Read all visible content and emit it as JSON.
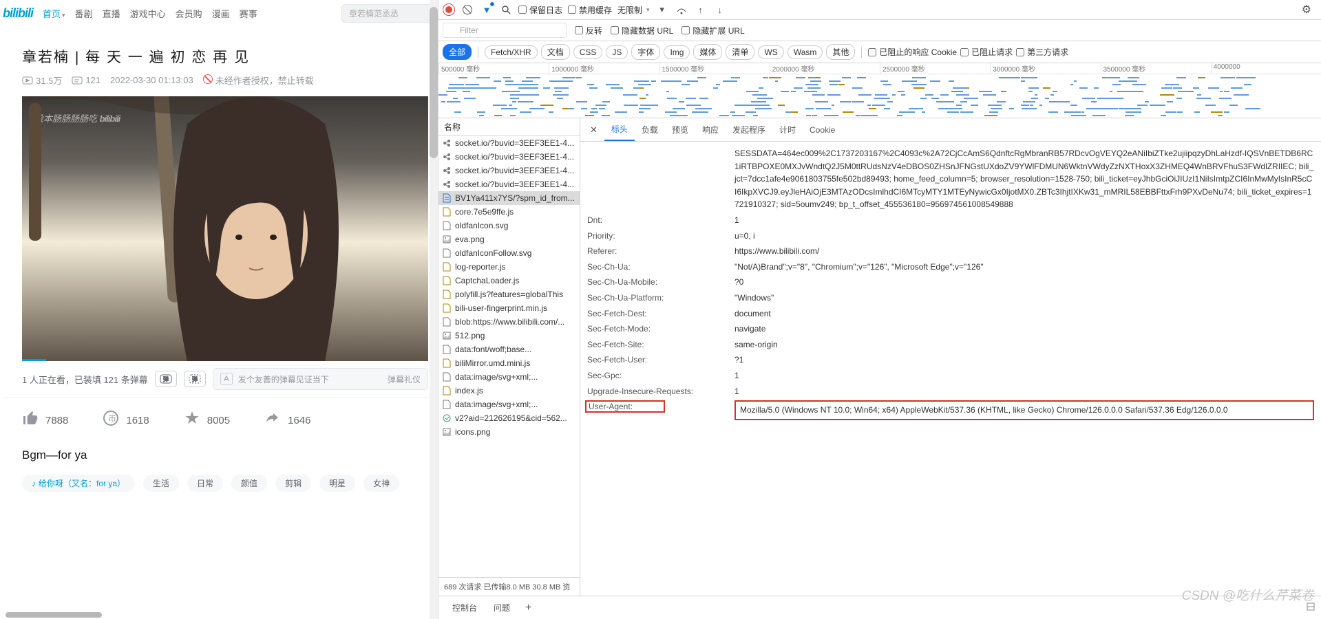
{
  "bili": {
    "logo": "bilibili",
    "nav": [
      "首页",
      "番剧",
      "直播",
      "游戏中心",
      "会员购",
      "漫画",
      "赛事"
    ],
    "search_placeholder": "章若楠范丞丞",
    "title": "章若楠 | 每 天 一 遍 初 恋 再 见",
    "views": "31.5万",
    "danmu_count": "121",
    "date": "2022-03-30 01:13:03",
    "forbid": "未经作者授权，禁止转载",
    "watermark_left": "绘本肠肠肠肠吃",
    "watermark_right": "bilibili",
    "watching": "1 人正在看，已装填 121 条弹幕",
    "danmu_A": "A",
    "danmu_placeholder": "发个友善的弹幕见证当下",
    "danmu_gift": "弹幕礼仪",
    "like": "7888",
    "coin": "1618",
    "fav": "8005",
    "share": "1646",
    "bgm": "Bgm—for ya",
    "tag_music": "给你呀（又名：for ya）",
    "tags": [
      "生活",
      "日常",
      "颜值",
      "剪辑",
      "明星",
      "女神"
    ]
  },
  "devtools": {
    "toolbar": {
      "keep_log": "保留日志",
      "disable_cache": "禁用缓存",
      "throttle": "无限制"
    },
    "filter_placeholder": "Filter",
    "filter_checks": [
      "反转",
      "隐藏数据 URL",
      "隐藏扩展 URL"
    ],
    "types": [
      "全部",
      "Fetch/XHR",
      "文档",
      "CSS",
      "JS",
      "字体",
      "Img",
      "媒体",
      "清单",
      "WS",
      "Wasm",
      "其他"
    ],
    "type_checks": [
      "已阻止的响应 Cookie",
      "已阻止请求",
      "第三方请求"
    ],
    "timeline_ticks": [
      "500000 毫秒",
      "1000000 毫秒",
      "1500000 毫秒",
      "2000000 毫秒",
      "2500000 毫秒",
      "3000000 毫秒",
      "3500000 毫秒",
      "4000000"
    ],
    "req_header": "名称",
    "requests": [
      {
        "icon": "ws",
        "name": "socket.io/?buvid=3EEF3EE1-4..."
      },
      {
        "icon": "ws",
        "name": "socket.io/?buvid=3EEF3EE1-4..."
      },
      {
        "icon": "ws",
        "name": "socket.io/?buvid=3EEF3EE1-4..."
      },
      {
        "icon": "ws",
        "name": "socket.io/?buvid=3EEF3EE1-4..."
      },
      {
        "icon": "doc",
        "name": "BV1Ya411x7YS/?spm_id_from...",
        "selected": true
      },
      {
        "icon": "script",
        "name": "core.7e5e9ffe.js"
      },
      {
        "icon": "file",
        "name": "oldfanIcon.svg"
      },
      {
        "icon": "img",
        "name": "eva.png"
      },
      {
        "icon": "file",
        "name": "oldfanIconFollow.svg"
      },
      {
        "icon": "script",
        "name": "log-reporter.js"
      },
      {
        "icon": "script",
        "name": "CaptchaLoader.js"
      },
      {
        "icon": "script",
        "name": "polyfill.js?features=globalThis"
      },
      {
        "icon": "script",
        "name": "bili-user-fingerprint.min.js"
      },
      {
        "icon": "file",
        "name": "blob:https://www.bilibili.com/..."
      },
      {
        "icon": "img",
        "name": "512.png"
      },
      {
        "icon": "file",
        "name": "data:font/woff;base..."
      },
      {
        "icon": "script",
        "name": "biliMirror.umd.mini.js"
      },
      {
        "icon": "file",
        "name": "data:image/svg+xml;..."
      },
      {
        "icon": "script",
        "name": "index.js"
      },
      {
        "icon": "file",
        "name": "data:image/svg+xml;..."
      },
      {
        "icon": "xhr",
        "name": "v2?aid=212626195&cid=562..."
      },
      {
        "icon": "img",
        "name": "icons.png"
      }
    ],
    "status": "689 次请求   已传输8.0 MB   30.8 MB 资",
    "detail_tabs": [
      "标头",
      "负载",
      "预览",
      "响应",
      "发起程序",
      "计时",
      "Cookie"
    ],
    "headers_top": "SESSDATA=464ec009%2C1737203167%2C4093c%2A72CjCcAmS6QdnftcRgMbranRB57RDcvOgVEYQ2eANiIbiZTke2ujiipqzyDhLaHzdf-IQSVnBETDB6RC1iRTBPOXE0MXJvWndtQ2J5M0ttRUdsNzV4eDBOS0ZHSnJFNGstUXdoZV9YWlFDMUN6WktnVWdyZzNXTHoxX3ZHMEQ4WnBRVFhuS3FWdlZRIIEC; bili_jct=7dcc1afe4e9061803755fe502bd89493; home_feed_column=5; browser_resolution=1528-750; bili_ticket=eyJhbGciOiJIUzI1NiIsImtpZCI6InMwMyIsInR5cCI6IkpXVCJ9.eyJleHAiOjE3MTAzODcsImlhdCI6MTcyMTY1MTEyNywicGx0IjotMX0.ZBTc3IhjtIXKw31_mMRIL58EBBFttxFrh9PXvDeNu74; bili_ticket_expires=1721910327; sid=5oumv249; bp_t_offset_455536180=956974561008549888",
    "headers": [
      {
        "n": "Dnt:",
        "v": "1"
      },
      {
        "n": "Priority:",
        "v": "u=0, i"
      },
      {
        "n": "Referer:",
        "v": "https://www.bilibili.com/"
      },
      {
        "n": "Sec-Ch-Ua:",
        "v": "\"Not/A)Brand\";v=\"8\", \"Chromium\";v=\"126\", \"Microsoft Edge\";v=\"126\""
      },
      {
        "n": "Sec-Ch-Ua-Mobile:",
        "v": "?0"
      },
      {
        "n": "Sec-Ch-Ua-Platform:",
        "v": "\"Windows\""
      },
      {
        "n": "Sec-Fetch-Dest:",
        "v": "document"
      },
      {
        "n": "Sec-Fetch-Mode:",
        "v": "navigate"
      },
      {
        "n": "Sec-Fetch-Site:",
        "v": "same-origin"
      },
      {
        "n": "Sec-Fetch-User:",
        "v": "?1"
      },
      {
        "n": "Sec-Gpc:",
        "v": "1"
      },
      {
        "n": "Upgrade-Insecure-Requests:",
        "v": "1"
      }
    ],
    "ua_name": "User-Agent:",
    "ua_val": "Mozilla/5.0 (Windows NT 10.0; Win64; x64) AppleWebKit/537.36 (KHTML, like Gecko) Chrome/126.0.0.0 Safari/537.36 Edg/126.0.0.0",
    "bottom_tabs": [
      "控制台",
      "问题"
    ],
    "csdn": "CSDN @吃什么芹菜卷"
  }
}
